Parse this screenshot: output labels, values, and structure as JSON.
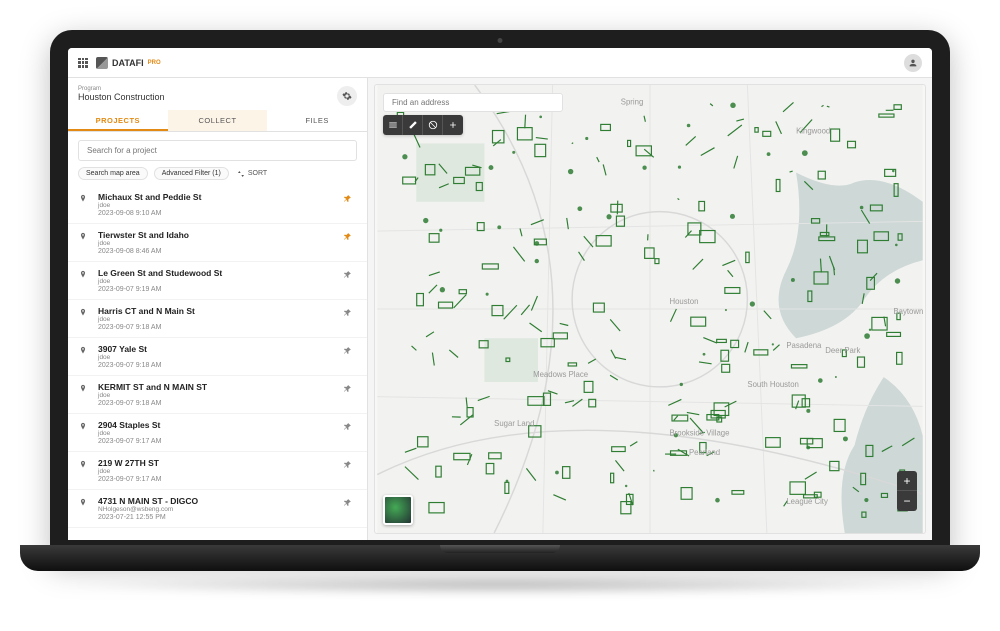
{
  "brand": {
    "name": "DATAFI",
    "sub": "PRO"
  },
  "program": {
    "label": "Program",
    "name": "Houston Construction"
  },
  "tabs": {
    "projects": "PROJECTS",
    "collect": "COLLECT",
    "files": "FILES"
  },
  "search": {
    "placeholder": "Search for a project"
  },
  "filters": {
    "map_area": "Search map area",
    "advanced": "Advanced Filter (1)",
    "sort": "SORT"
  },
  "map": {
    "search_placeholder": "Find an address"
  },
  "projects": [
    {
      "title": "Michaux St and Peddie St",
      "user": "jdoe",
      "date": "2023-09-08 9:10 AM",
      "pinned": true
    },
    {
      "title": "Tierwster St and Idaho",
      "user": "jdoe",
      "date": "2023-09-08 8:46 AM",
      "pinned": true
    },
    {
      "title": "Le Green St and Studewood St",
      "user": "jdoe",
      "date": "2023-09-07 9:19 AM",
      "pinned": false
    },
    {
      "title": "Harris CT and N Main St",
      "user": "jdoe",
      "date": "2023-09-07 9:18 AM",
      "pinned": false
    },
    {
      "title": "3907 Yale St",
      "user": "jdoe",
      "date": "2023-09-07 9:18 AM",
      "pinned": false
    },
    {
      "title": "KERMIT ST and N MAIN ST",
      "user": "jdoe",
      "date": "2023-09-07 9:18 AM",
      "pinned": false
    },
    {
      "title": "2904 Staples St",
      "user": "jdoe",
      "date": "2023-09-07 9:17 AM",
      "pinned": false
    },
    {
      "title": "219 W 27TH ST",
      "user": "jdoe",
      "date": "2023-09-07 9:17 AM",
      "pinned": false
    },
    {
      "title": "4731 N MAIN ST - DIGCO",
      "user": "NHolgeson@wsbeng.com",
      "date": "2023-07-21 12:55 PM",
      "pinned": false
    }
  ],
  "map_labels": {
    "houston": "Houston",
    "pasadena": "Pasadena",
    "pearland": "Pearland",
    "sugarland": "Sugar Land",
    "spring": "Spring",
    "kingwood": "Kingwood",
    "baytown": "Baytown",
    "deerpark": "Deer Park",
    "leaguecity": "League City",
    "meadows": "Meadows Place",
    "southhouston": "South Houston",
    "brookside": "Brookside Village"
  }
}
